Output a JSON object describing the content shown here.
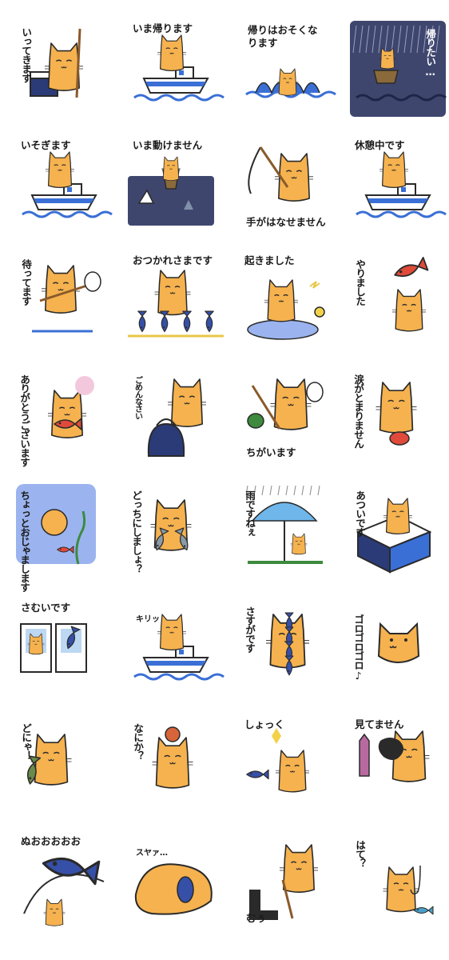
{
  "stickers": [
    {
      "name": "sticker-ittekimasu",
      "caption": "いってきます",
      "layout": "v",
      "scene": "cooler"
    },
    {
      "name": "sticker-ima-kaerimasu",
      "caption": "いま帰ります",
      "layout": "top",
      "scene": "boat"
    },
    {
      "name": "sticker-kaeri-osoku",
      "caption": "帰りはおそくなります",
      "layout": "top2",
      "scene": "splash"
    },
    {
      "name": "sticker-kaeritai",
      "caption": "帰りたい…",
      "layout": "v-white",
      "scene": "night"
    },
    {
      "name": "sticker-isogimasu",
      "caption": "いそぎます",
      "layout": "top",
      "scene": "boat"
    },
    {
      "name": "sticker-ima-ugokemasen",
      "caption": "いま動けません",
      "layout": "top",
      "scene": "shark"
    },
    {
      "name": "sticker-te-ga-hanasemasen",
      "caption": "手がはなせません",
      "layout": "bottom",
      "scene": "rod"
    },
    {
      "name": "sticker-kyukeichu",
      "caption": "休憩中です",
      "layout": "top",
      "scene": "boat"
    },
    {
      "name": "sticker-matte-masu",
      "caption": "待ってます",
      "layout": "v",
      "scene": "fishing"
    },
    {
      "name": "sticker-otsukare",
      "caption": "おつかれさまです",
      "layout": "top",
      "scene": "fish-row"
    },
    {
      "name": "sticker-okimashita",
      "caption": "起きました",
      "layout": "top",
      "scene": "cloud"
    },
    {
      "name": "sticker-yarimashita",
      "caption": "やりました",
      "layout": "v",
      "scene": "fish-up"
    },
    {
      "name": "sticker-arigatou",
      "caption": "ありがとうございます",
      "layout": "v2",
      "scene": "fish-hug"
    },
    {
      "name": "sticker-gomennasai",
      "caption": "ごめんなさい",
      "layout": "v-small",
      "scene": "bag"
    },
    {
      "name": "sticker-chigaimasu",
      "caption": "ちがいます",
      "layout": "bottom",
      "scene": "turtle"
    },
    {
      "name": "sticker-namida",
      "caption": "涙がとまりません",
      "layout": "v2",
      "scene": "crab"
    },
    {
      "name": "sticker-chotto-ojama",
      "caption": "ちょっとおじゃまします",
      "layout": "v2",
      "scene": "water"
    },
    {
      "name": "sticker-docchi",
      "caption": "どっちにしましょ？",
      "layout": "v2",
      "scene": "two-fish"
    },
    {
      "name": "sticker-ame-desu-ne",
      "caption": "雨ですねぇ",
      "layout": "v",
      "scene": "umbrella"
    },
    {
      "name": "sticker-atsui",
      "caption": "あついです",
      "layout": "v",
      "scene": "cooler-big"
    },
    {
      "name": "sticker-samui",
      "caption": "さむいです",
      "layout": "top",
      "scene": "ice-boxes"
    },
    {
      "name": "sticker-kiri",
      "caption": "キリッ",
      "layout": "top-small",
      "scene": "boat"
    },
    {
      "name": "sticker-sasuga",
      "caption": "さすがです",
      "layout": "v",
      "scene": "fish-wall"
    },
    {
      "name": "sticker-goro",
      "caption": "ゴロゴロゴロ♪",
      "layout": "v-pink",
      "scene": "head"
    },
    {
      "name": "sticker-donya",
      "caption": "どにゃ！",
      "layout": "v",
      "scene": "fish-hold"
    },
    {
      "name": "sticker-nanika",
      "caption": "なにか？",
      "layout": "v",
      "scene": "octopus"
    },
    {
      "name": "sticker-shokku",
      "caption": "しょっく",
      "layout": "top",
      "scene": "fall"
    },
    {
      "name": "sticker-mitemasen",
      "caption": "見てません",
      "layout": "top",
      "scene": "ink"
    },
    {
      "name": "sticker-nuoo",
      "caption": "ぬおおおおお",
      "layout": "top",
      "scene": "tuna"
    },
    {
      "name": "sticker-suya",
      "caption": "スヤァ…",
      "layout": "top-small",
      "scene": "sleep"
    },
    {
      "name": "sticker-muu",
      "caption": "むぅ",
      "layout": "bottom",
      "scene": "boot"
    },
    {
      "name": "sticker-hate",
      "caption": "はて？",
      "layout": "v",
      "scene": "hook"
    }
  ],
  "colors": {
    "cat": "#f5b24f",
    "cat_shade": "#e9a043",
    "outline": "#2a2a2a",
    "blue": "#3a6fd6",
    "navy": "#2b3b78",
    "night": "#3f466e",
    "sky": "#9bb4ef",
    "fish_red": "#e04a3a",
    "fish_blue": "#3650a8",
    "green": "#3e8a3e",
    "pink": "#f3c8dd"
  }
}
